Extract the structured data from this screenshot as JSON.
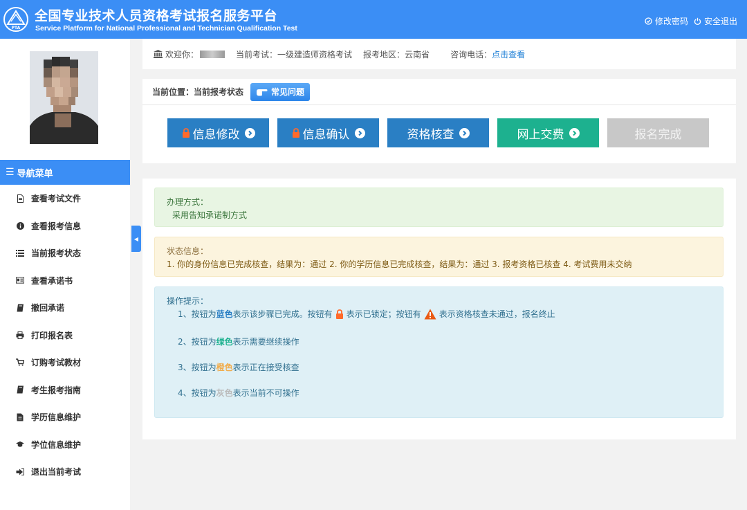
{
  "header": {
    "title_zh": "全国专业技术人员资格考试报名服务平台",
    "title_en": "Service Platform for National Professional and Technician Qualification Test",
    "logo_text": "PTA",
    "change_password": "修改密码",
    "logout": "安全退出",
    "color": "#3b8ef5"
  },
  "sidebar": {
    "nav_title": "导航菜单",
    "items": [
      {
        "label": "查看考试文件",
        "icon": "document-icon"
      },
      {
        "label": "查看报考信息",
        "icon": "info-icon"
      },
      {
        "label": "当前报考状态",
        "icon": "list-icon"
      },
      {
        "label": "查看承诺书",
        "icon": "id-card-icon"
      },
      {
        "label": "撤回承诺",
        "icon": "book-icon"
      },
      {
        "label": "打印报名表",
        "icon": "printer-icon"
      },
      {
        "label": "订购考试教材",
        "icon": "cart-icon"
      },
      {
        "label": "考生报考指南",
        "icon": "book-icon"
      },
      {
        "label": "学历信息维护",
        "icon": "file-icon"
      },
      {
        "label": "学位信息维护",
        "icon": "graduation-cap-icon"
      },
      {
        "label": "退出当前考试",
        "icon": "sign-out-icon"
      }
    ],
    "collapse_glyph": "◀"
  },
  "infobar": {
    "welcome_label": "欢迎你：",
    "exam_label": "当前考试：",
    "exam_value": "一级建造师资格考试",
    "region_label": "报考地区：",
    "region_value": "云南省",
    "phone_label": "咨询电话：",
    "phone_link": "点击查看"
  },
  "position": {
    "label": "当前位置：当前报考状态",
    "faq_button": "常见问题"
  },
  "steps": [
    {
      "label": "信息修改",
      "state": "blue",
      "locked": true,
      "arrow": true
    },
    {
      "label": "信息确认",
      "state": "blue",
      "locked": true,
      "arrow": true
    },
    {
      "label": "资格核查",
      "state": "blue",
      "locked": false,
      "arrow": true
    },
    {
      "label": "网上交费",
      "state": "green",
      "locked": false,
      "arrow": true
    },
    {
      "label": "报名完成",
      "state": "gray",
      "locked": false,
      "arrow": false
    }
  ],
  "method_box": {
    "title": "办理方式：",
    "text": "采用告知承诺制方式"
  },
  "status_box": {
    "title": "状态信息：",
    "text": "1. 你的身份信息已完成核查，结果为：通过 2. 你的学历信息已完成核查，结果为：通过 3. 报考资格已核查 4. 考试费用未交纳"
  },
  "tips_box": {
    "title": "操作提示：",
    "tip1": {
      "pre": "1、按钮为",
      "color_word": "蓝色",
      "mid": "表示该步骤已完成。按钮有",
      "mid2": "表示已锁定；按钮有",
      "post": "表示资格核查未通过，报名终止"
    },
    "tip2": {
      "pre": "2、按钮为",
      "color_word": "绿色",
      "post": "表示需要继续操作"
    },
    "tip3": {
      "pre": "3、按钮为",
      "color_word": "橙色",
      "post": "表示正在接受核查"
    },
    "tip4": {
      "pre": "4、按钮为",
      "color_word": "灰色",
      "post": "表示当前不可操作"
    }
  }
}
